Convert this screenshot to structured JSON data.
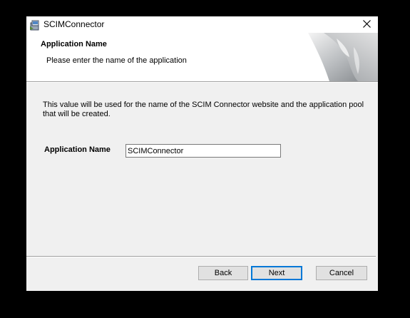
{
  "window": {
    "title": "SCIMConnector",
    "icon": "installer-icon",
    "close_icon": "close-icon"
  },
  "banner": {
    "title": "Application Name",
    "subtitle": "Please enter the name of the application"
  },
  "content": {
    "description": "This value will be used for the name of the SCIM Connector website and the application pool that will be created.",
    "field_label": "Application Name",
    "field_value": "SCIMConnector"
  },
  "buttons": {
    "back": "Back",
    "next": "Next",
    "cancel": "Cancel"
  },
  "colors": {
    "dialog_background": "#f0f0f0",
    "banner_background": "#ffffff",
    "default_button_border": "#0078d7"
  }
}
